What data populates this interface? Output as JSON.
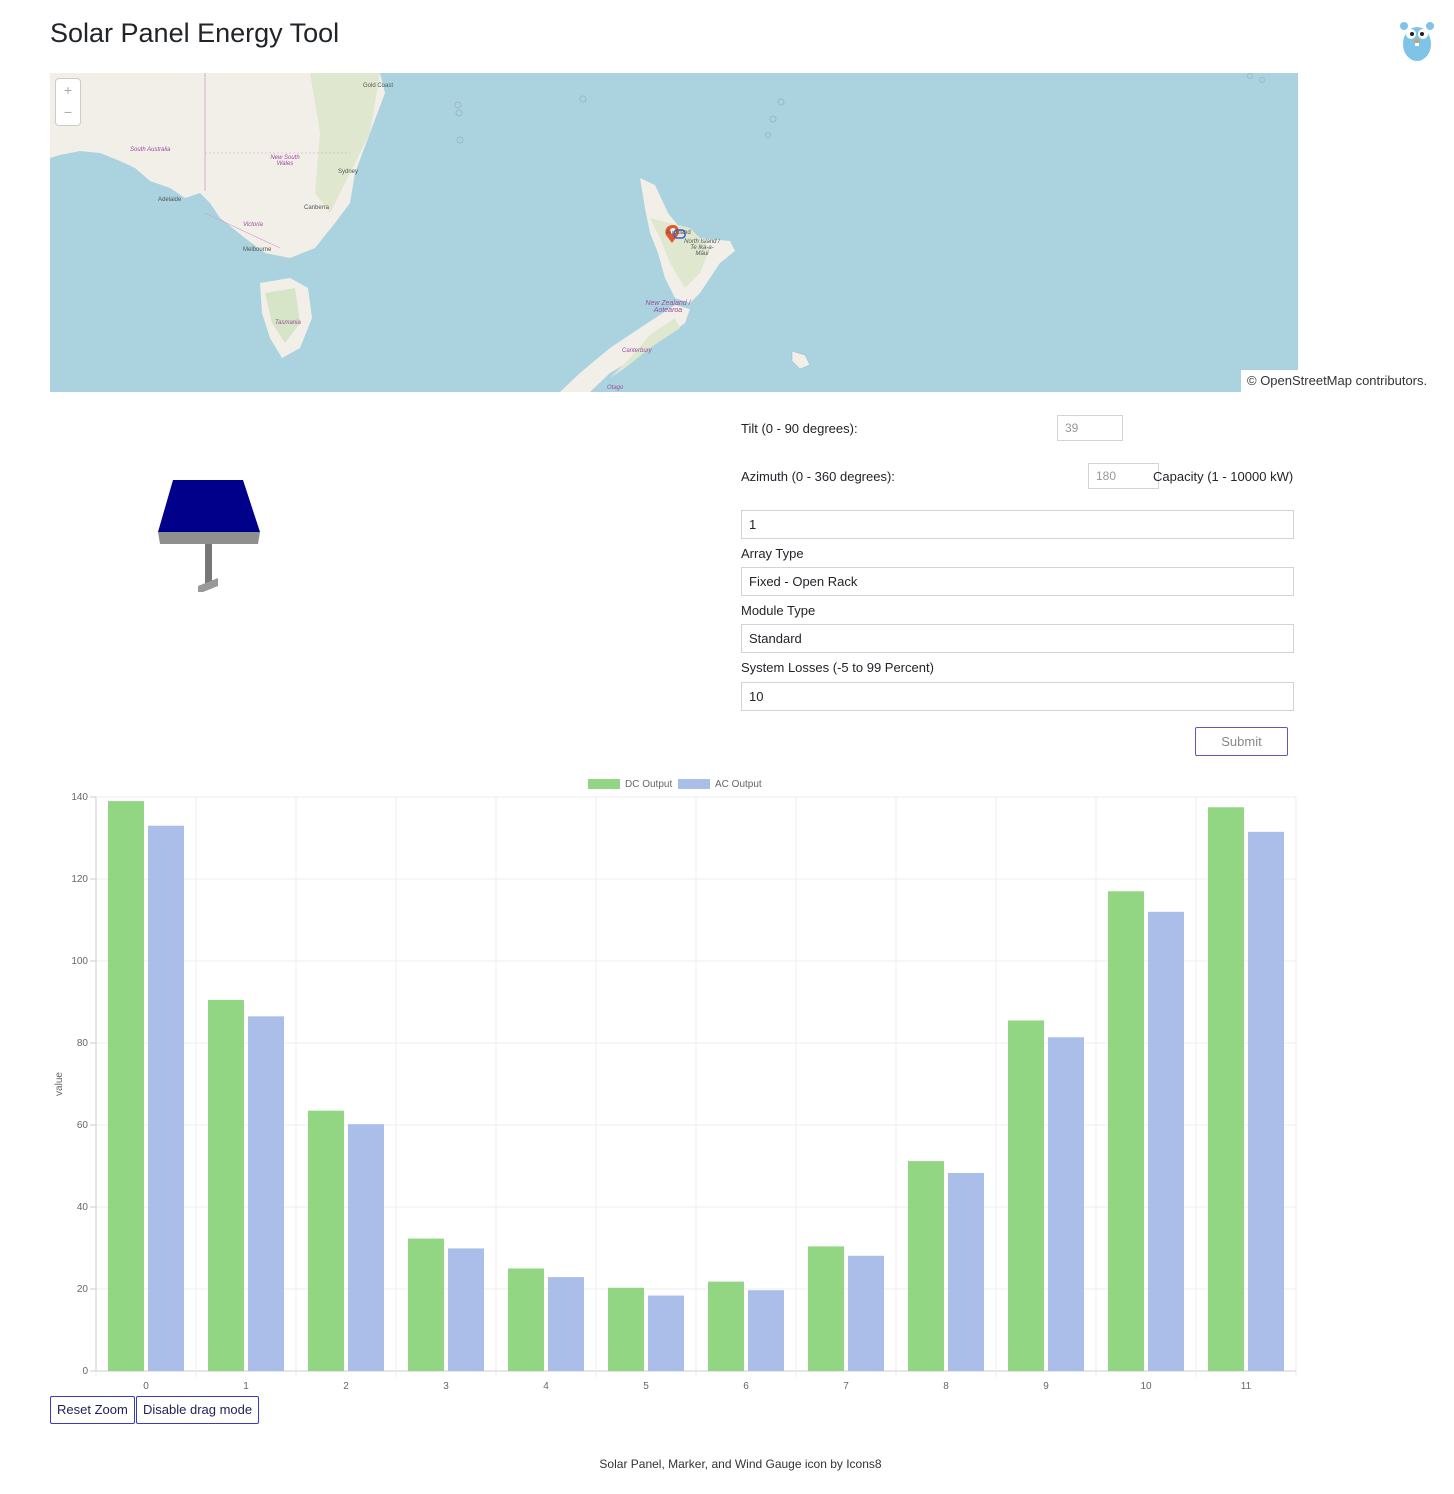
{
  "app": {
    "title": "Solar Panel Energy Tool"
  },
  "map": {
    "zoom_in": "+",
    "zoom_out": "−",
    "attribution": "© OpenStreetMap contributors.",
    "places": {
      "gold_coast": "Gold Coast",
      "south_australia": "South Australia",
      "new_south_wales": "New South Wales",
      "sydney": "Sydney",
      "adelaide": "Adelaide",
      "canberra": "Canberra",
      "victoria": "Victoria",
      "melbourne": "Melbourne",
      "tasmania": "Tasmania",
      "auckland": "Auckland",
      "north_island": "North Island / Te Ika-a-Māui",
      "new_zealand": "New Zealand / Aotearoa",
      "canterbury": "Canterbury",
      "otago": "Otago"
    }
  },
  "form": {
    "tilt_label": "Tilt (0 - 90 degrees):",
    "tilt_value": "39",
    "azimuth_label": "Azimuth (0 - 360 degrees):",
    "azimuth_value": "180",
    "capacity_label": "Capacity (1 - 10000 kW)",
    "capacity_value": "1",
    "array_type_label": "Array Type",
    "array_type_value": "Fixed - Open Rack",
    "module_type_label": "Module Type",
    "module_type_value": "Standard",
    "losses_label": "System Losses (-5 to 99 Percent)",
    "losses_value": "10",
    "submit_label": "Submit"
  },
  "chart_data": {
    "type": "bar",
    "categories": [
      "0",
      "1",
      "2",
      "3",
      "4",
      "5",
      "6",
      "7",
      "8",
      "9",
      "10",
      "11"
    ],
    "series": [
      {
        "name": "DC Output",
        "color": "#92d684",
        "values": [
          139,
          90.5,
          63.5,
          32.3,
          25,
          20.3,
          21.8,
          30.4,
          51.2,
          85.5,
          117,
          137.5
        ]
      },
      {
        "name": "AC Output",
        "color": "#abbeea",
        "values": [
          133,
          86.5,
          60.2,
          29.9,
          22.9,
          18.4,
          19.7,
          28.1,
          48.3,
          81.4,
          112,
          131.5
        ]
      }
    ],
    "ylabel": "value",
    "ylim": [
      0,
      140
    ],
    "yticks": [
      0,
      20,
      40,
      60,
      80,
      100,
      120,
      140
    ],
    "legend": "top-center",
    "grid": true
  },
  "controls": {
    "reset_zoom": "Reset Zoom",
    "drag_mode": "Disable drag mode"
  },
  "footer": {
    "credit": "Solar Panel, Marker, and Wind Gauge icon by Icons8"
  }
}
